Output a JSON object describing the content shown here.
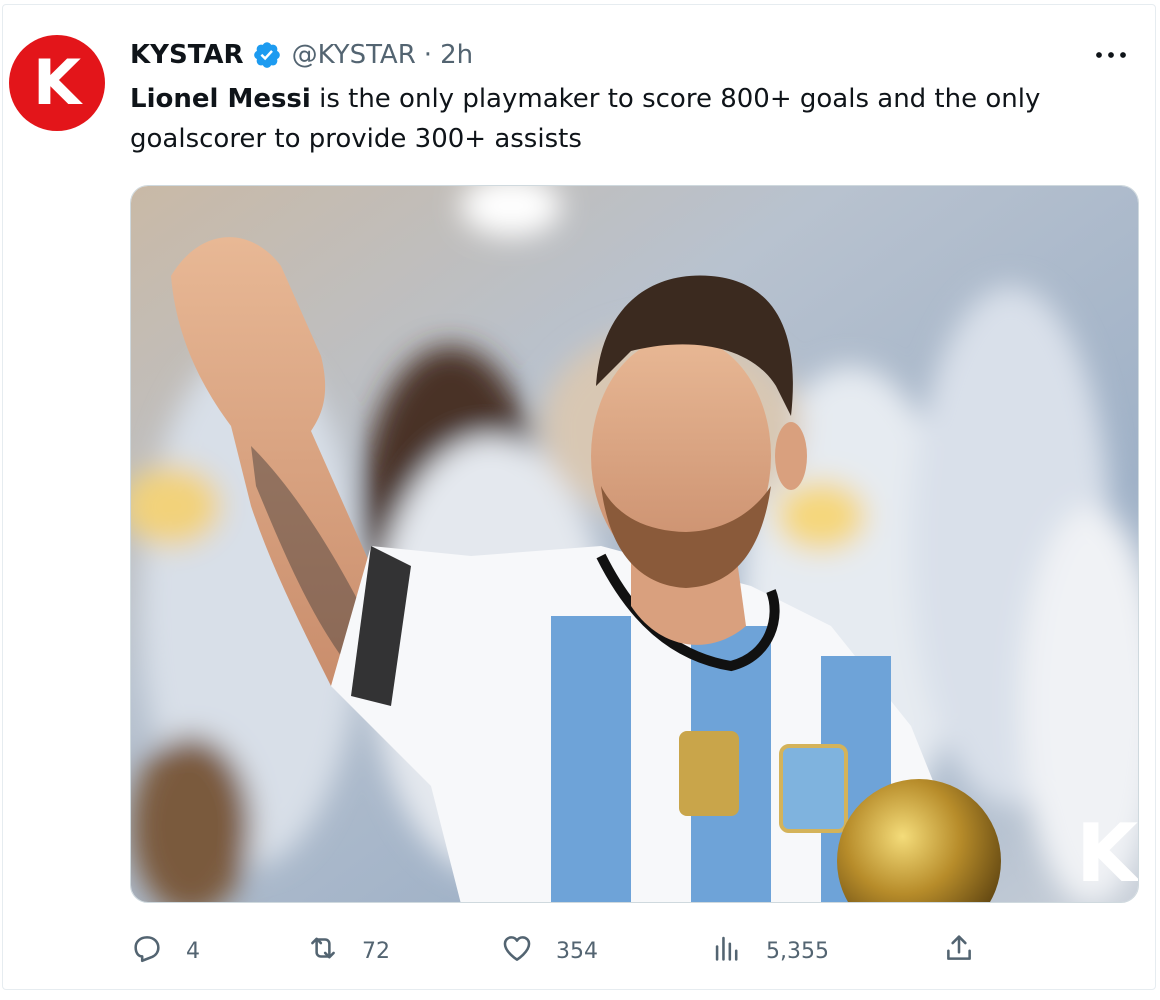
{
  "tweet": {
    "avatar_letter": "K",
    "author_name": "KYSTAR",
    "handle": "@KYSTAR",
    "separator": "·",
    "time": "2h",
    "text_bold": "Lionel Messi",
    "text_rest": " is the only playmaker to score 800+ goals and the only goalscorer to provide 300+ assists",
    "media_watermark": "K"
  },
  "actions": {
    "reply_count": "4",
    "retweet_count": "72",
    "like_count": "354",
    "views_count": "5,355"
  },
  "icons": {
    "verified": "verified-badge-icon",
    "more": "more-icon",
    "reply": "reply-icon",
    "retweet": "retweet-icon",
    "like": "heart-icon",
    "views": "views-icon",
    "share": "share-icon"
  },
  "colors": {
    "brand_red": "#e3151a",
    "verified_blue": "#1d9bf0",
    "secondary_text": "#536471"
  }
}
